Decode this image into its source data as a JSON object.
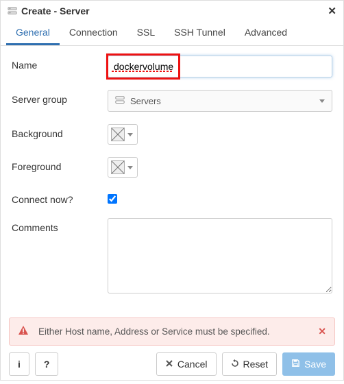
{
  "title": "Create - Server",
  "tabs": [
    {
      "label": "General"
    },
    {
      "label": "Connection"
    },
    {
      "label": "SSL"
    },
    {
      "label": "SSH Tunnel"
    },
    {
      "label": "Advanced"
    }
  ],
  "activeTab": 0,
  "form": {
    "name_label": "Name",
    "name_value": "dockervolume",
    "server_group_label": "Server group",
    "server_group_value": "Servers",
    "background_label": "Background",
    "foreground_label": "Foreground",
    "connect_now_label": "Connect now?",
    "connect_now_checked": true,
    "comments_label": "Comments",
    "comments_value": ""
  },
  "alert": {
    "message": "Either Host name, Address or Service must be specified."
  },
  "buttons": {
    "info": "i",
    "help": "?",
    "cancel": "Cancel",
    "reset": "Reset",
    "save": "Save"
  }
}
